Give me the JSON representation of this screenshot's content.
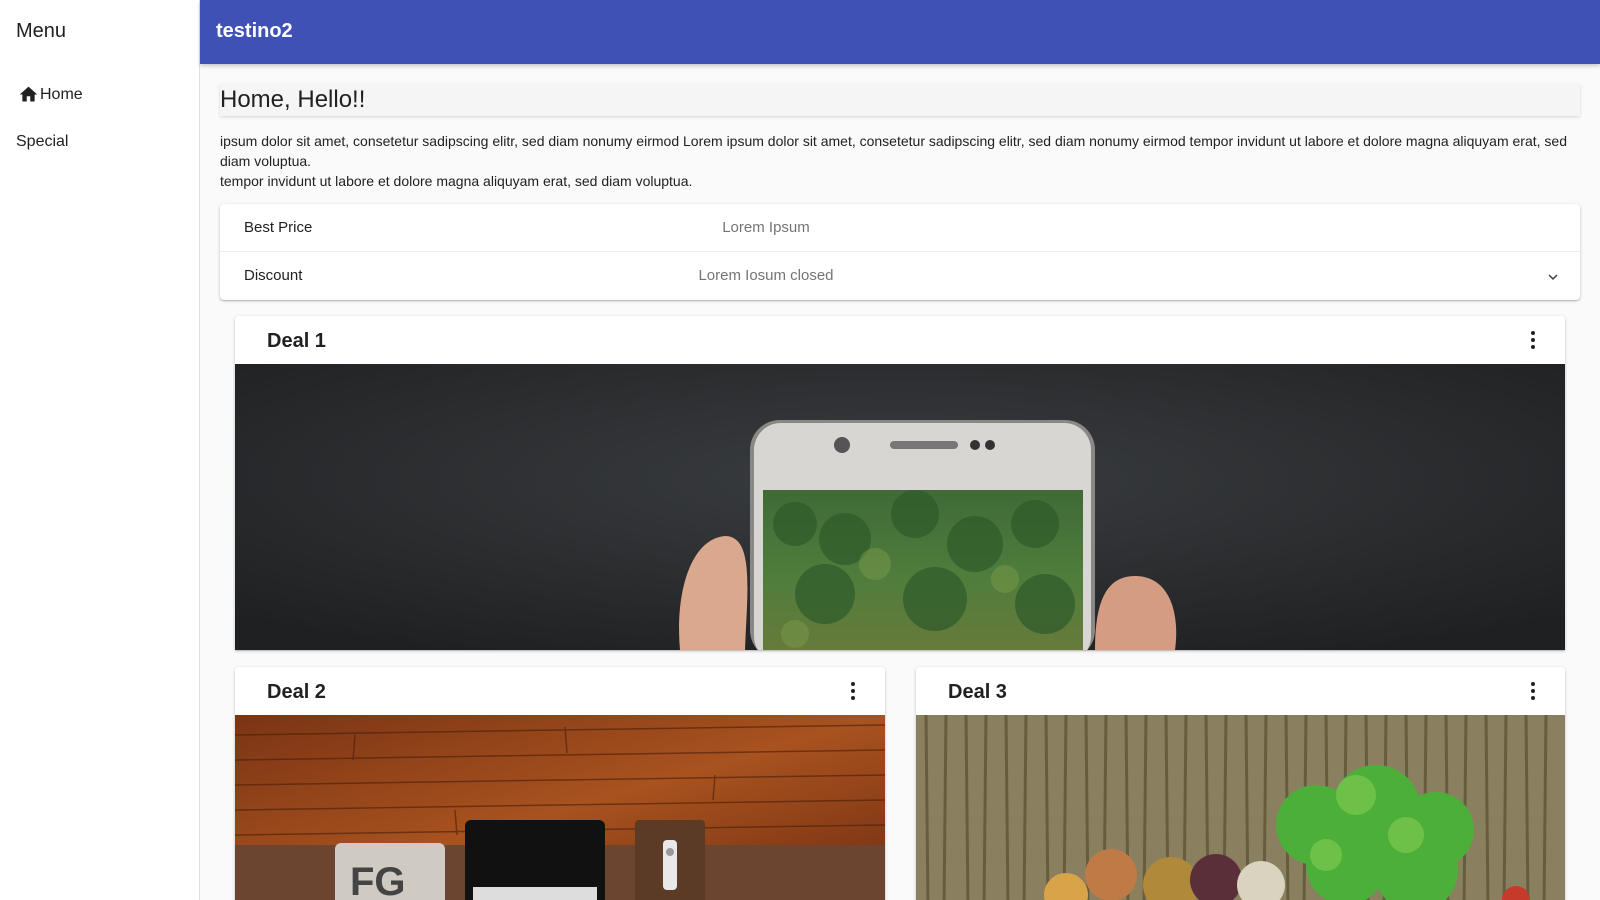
{
  "sidebar": {
    "title": "Menu",
    "items": [
      {
        "label": "Home",
        "icon": "home-icon"
      },
      {
        "label": "Special"
      }
    ]
  },
  "topbar": {
    "title": "testino2"
  },
  "page": {
    "heading": "Home, Hello!!",
    "intro_line1": "ipsum dolor sit amet, consetetur sadipscing elitr, sed diam nonumy eirmod Lorem ipsum dolor sit amet, consetetur sadipscing elitr, sed diam nonumy eirmod tempor invidunt ut labore et dolore magna aliquyam erat, sed diam voluptua.",
    "intro_line2": "tempor invidunt ut labore et dolore magna aliquyam erat, sed diam voluptua."
  },
  "info": {
    "rows": [
      {
        "label": "Best Price",
        "value": "Lorem Ipsum"
      },
      {
        "label": "Discount",
        "value": "Lorem Iosum closed"
      }
    ]
  },
  "deals": [
    {
      "title": "Deal 1",
      "image": "hand holding smartphone showing forest"
    },
    {
      "title": "Deal 2",
      "image": "laptop on wooden floor"
    },
    {
      "title": "Deal 3",
      "image": "basket of vegetables"
    }
  ],
  "colors": {
    "primary": "#3f51b5",
    "background": "#fafafa"
  }
}
